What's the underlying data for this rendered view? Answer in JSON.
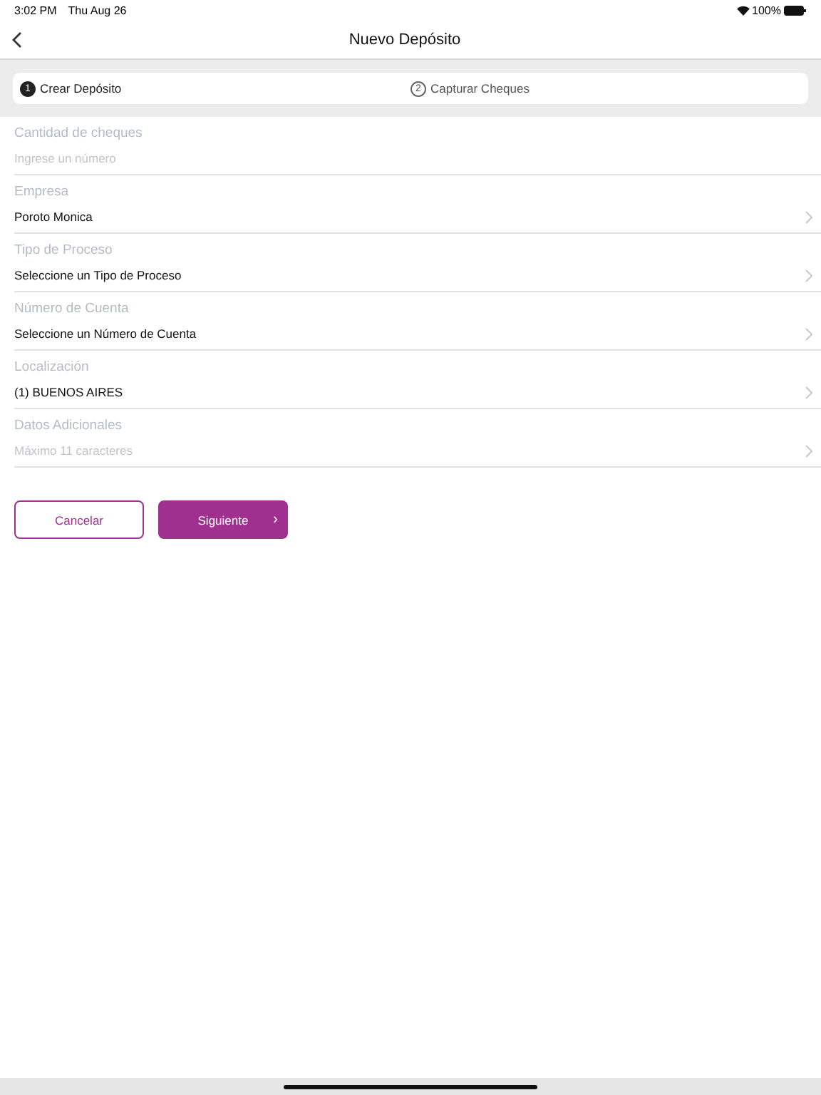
{
  "status_bar": {
    "time": "3:02 PM",
    "date": "Thu Aug 26",
    "battery": "100%"
  },
  "nav": {
    "title": "Nuevo Depósito"
  },
  "steps": [
    {
      "number": "1",
      "label": "Crear Depósito",
      "selected": true
    },
    {
      "number": "2",
      "label": "Capturar Cheques",
      "selected": false
    }
  ],
  "fields": [
    {
      "kind": "input",
      "label": "Cantidad de cheques",
      "placeholder": "Ingrese un número"
    },
    {
      "kind": "select",
      "label": "Empresa",
      "value": "Poroto Monica"
    },
    {
      "kind": "select",
      "label": "Tipo de Proceso",
      "value": "Seleccione un Tipo de Proceso"
    },
    {
      "kind": "select",
      "label": "Número de Cuenta",
      "value": "Seleccione un Número de Cuenta"
    },
    {
      "kind": "select",
      "label": "Localización",
      "value": "(1) BUENOS AIRES"
    },
    {
      "kind": "select",
      "label": "Datos Adicionales",
      "placeholder": "Máximo 11 caracteres"
    }
  ],
  "buttons": [
    {
      "kind": "secondary",
      "label": "Cancelar"
    },
    {
      "kind": "primary",
      "label": "Siguiente",
      "arrow": "›"
    }
  ]
}
